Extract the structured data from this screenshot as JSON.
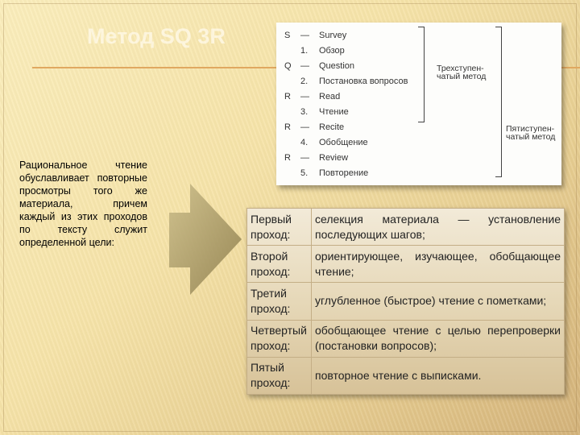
{
  "title": "Метод SQ 3R",
  "scan": {
    "rows": [
      {
        "letter": "S",
        "dash": "—",
        "word": "Survey"
      },
      {
        "letter": "",
        "dash": "1.",
        "word": "Обзор"
      },
      {
        "letter": "Q",
        "dash": "—",
        "word": "Question"
      },
      {
        "letter": "",
        "dash": "2.",
        "word": "Постановка вопросов"
      },
      {
        "letter": "R",
        "dash": "—",
        "word": "Read"
      },
      {
        "letter": "",
        "dash": "3.",
        "word": "Чтение"
      },
      {
        "letter": "R",
        "dash": "—",
        "word": "Recite"
      },
      {
        "letter": "",
        "dash": "4.",
        "word": "Обобщение"
      },
      {
        "letter": "R",
        "dash": "—",
        "word": "Review"
      },
      {
        "letter": "",
        "dash": "5.",
        "word": "Повторение"
      }
    ],
    "three_step": "Трехступен-\nчатый метод",
    "five_step": "Пятиступен-\nчатый метод"
  },
  "left_text": "Рациональное чтение обуславливает повторные просмотры того же материала, причем каждый из этих проходов по тексту служит определенной цели:",
  "table": [
    {
      "k": "Первый проход:",
      "v": "селекция материала — установление последующих шагов;"
    },
    {
      "k": "Второй проход:",
      "v": "ориентирующее, изучающее, обобщающее чтение;"
    },
    {
      "k": "Третий проход:",
      "v": "углубленное (быстрое) чтение с пометками;"
    },
    {
      "k": "Четвертый проход:",
      "v": "обобщающее чтение с целью перепроверки (постановки вопросов);"
    },
    {
      "k": "Пятый проход:",
      "v": "повторное чтение с выписками."
    }
  ]
}
